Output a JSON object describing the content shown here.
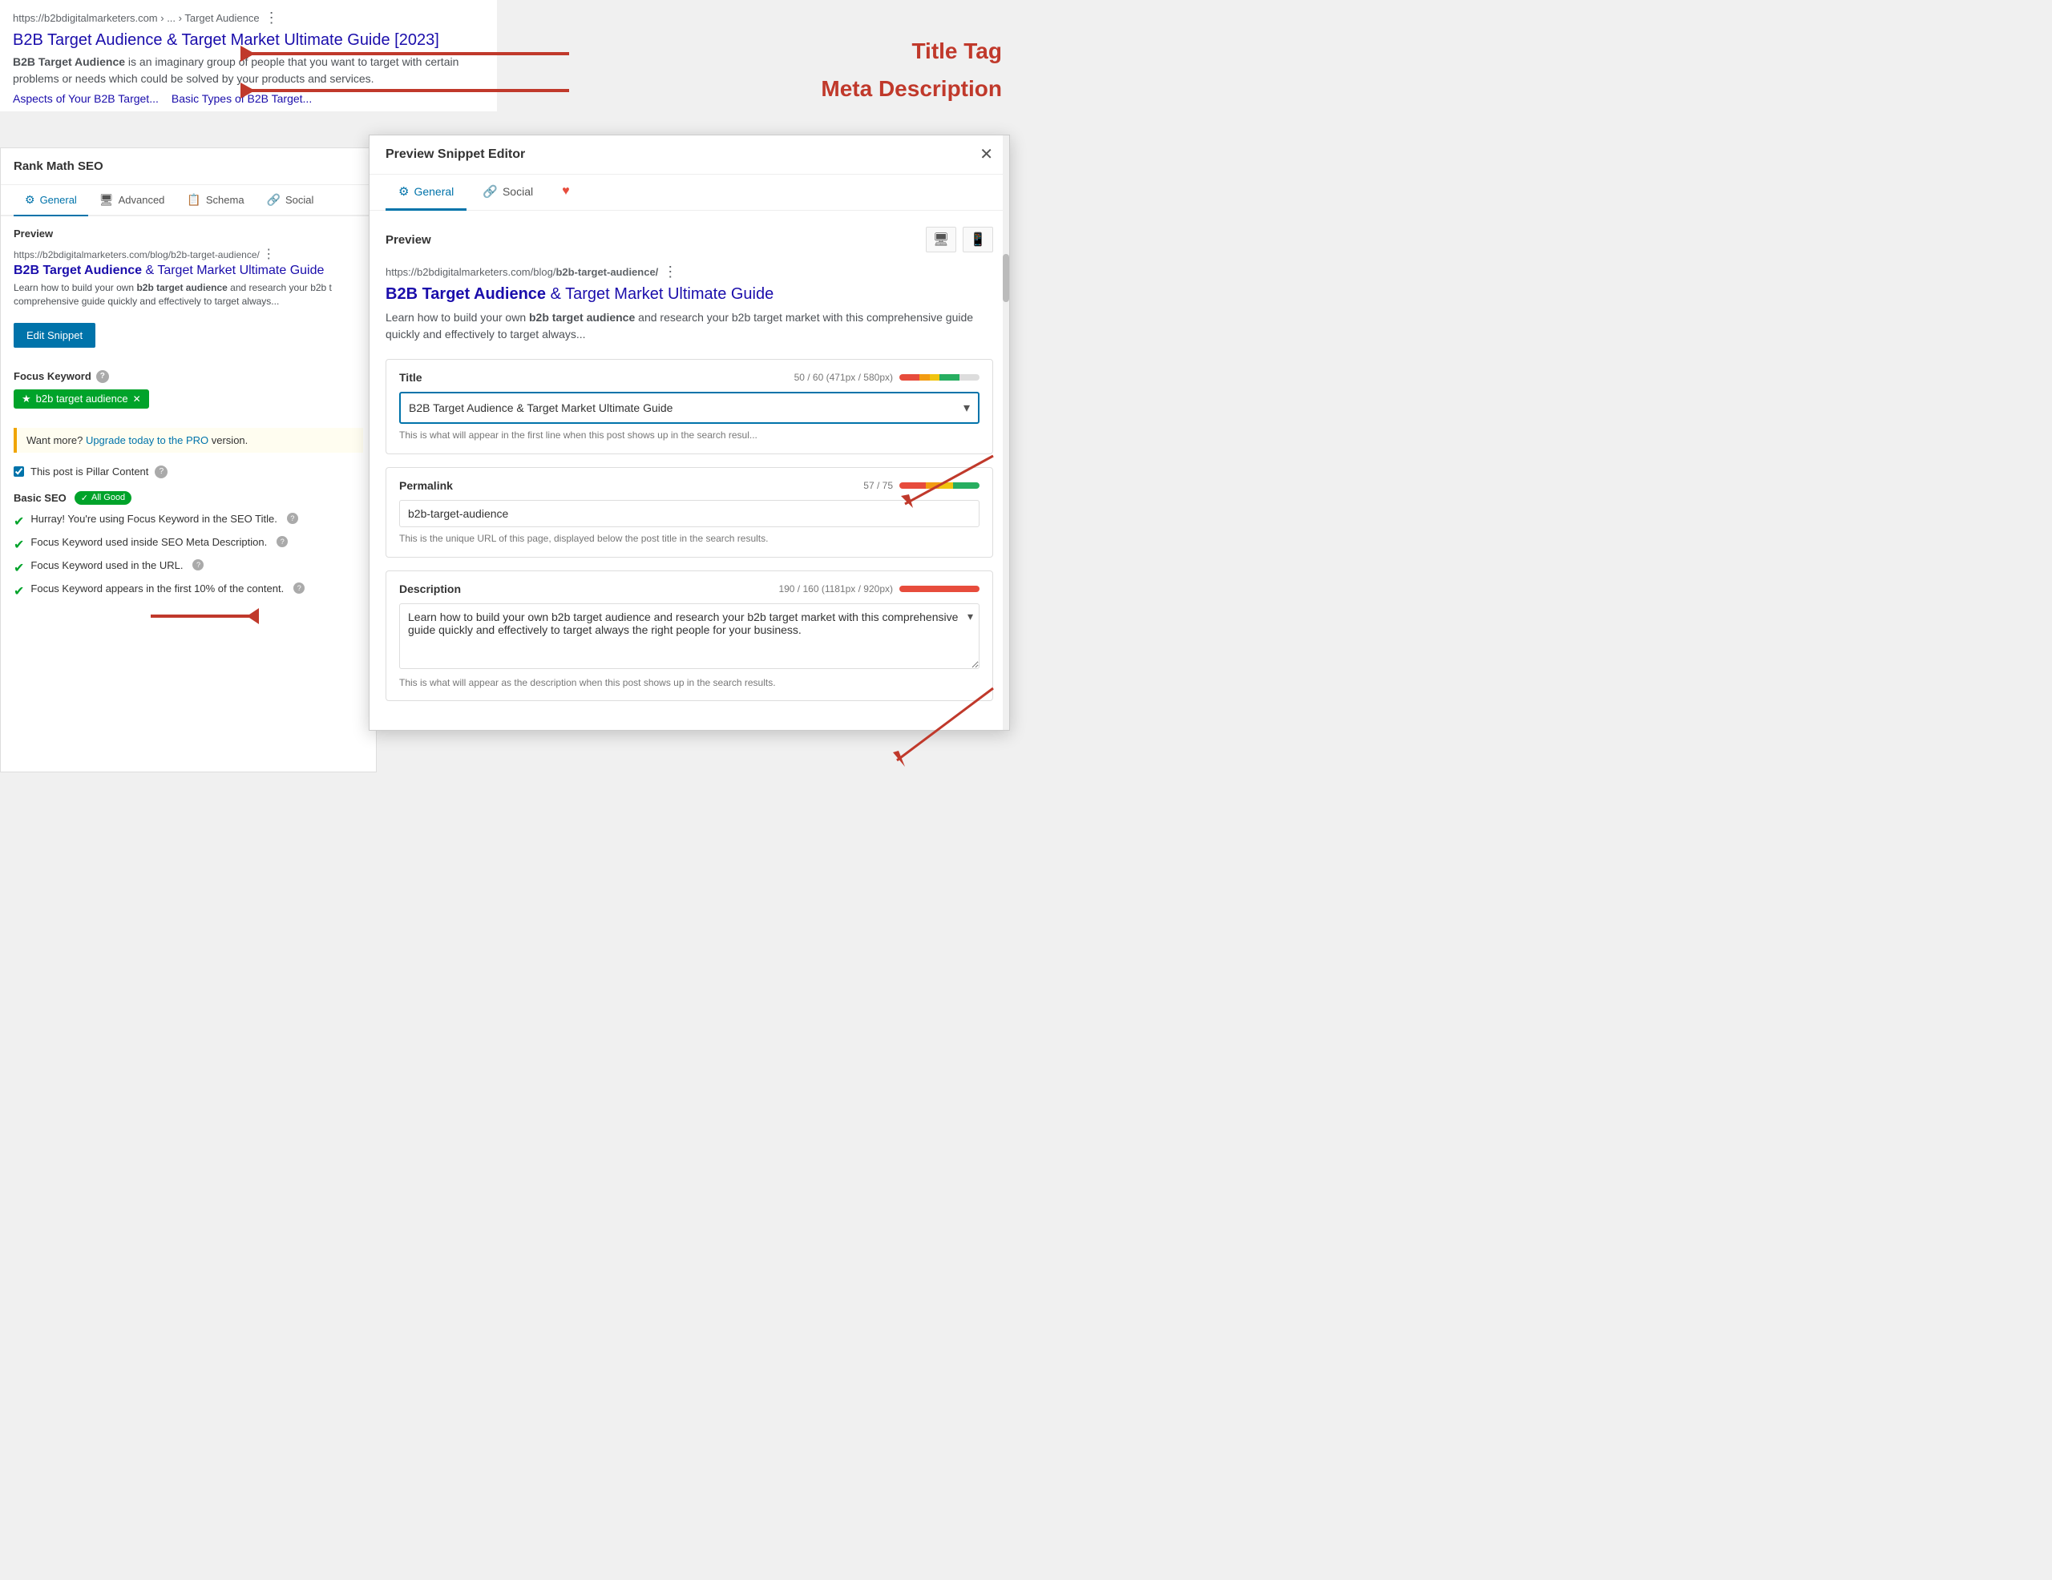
{
  "serp": {
    "url": "https://b2bdigitalmarketers.com › ... › Target Audience",
    "url_dots": "⋮",
    "title": "B2B Target Audience & Target Market Ultimate Guide [2023]",
    "description_bold": "B2B Target Audience",
    "description_rest": " is an imaginary group of people that you want to target with certain problems or needs which could be solved by your products and services.",
    "link1": "Aspects of Your B2B Target...",
    "link2": "Basic Types of B2B Target..."
  },
  "annotations": {
    "title_tag": "Title Tag",
    "meta_desc": "Meta Description"
  },
  "rank_math": {
    "header": "Rank Math SEO",
    "tabs": [
      {
        "label": "General",
        "icon": "⚙",
        "active": true
      },
      {
        "label": "Advanced",
        "icon": "🖥",
        "active": false
      },
      {
        "label": "Schema",
        "icon": "📋",
        "active": false
      },
      {
        "label": "Social",
        "icon": "🔗",
        "active": false
      }
    ],
    "preview_label": "Preview",
    "preview_url": "https://b2bdigitalmarketers.com/blog/",
    "preview_url_bold": "b2b-target-audience/",
    "preview_title_normal": "& Target Market Ultimate Guide",
    "preview_title_bold": "B2B Target Audience",
    "preview_desc": "Learn how to build your own ",
    "preview_desc_bold": "b2b target audience",
    "preview_desc_rest": " and research your b2b t comprehensive guide quickly and effectively to target always...",
    "edit_snippet_label": "Edit Snippet",
    "focus_keyword_label": "Focus Keyword",
    "focus_keyword_tag": "b2b target audience",
    "upgrade_text": "Want more? ",
    "upgrade_link": "Upgrade today to the PRO",
    "upgrade_rest": " version.",
    "pillar_label": "This post is Pillar Content",
    "basic_seo_label": "Basic SEO",
    "all_good_label": "✓ All Good",
    "seo_checks": [
      "Hurray! You're using Focus Keyword in the SEO Title.",
      "Focus Keyword used inside SEO Meta Description.",
      "Focus Keyword used in the URL.",
      "Focus Keyword appears in the first 10% of the content."
    ]
  },
  "modal": {
    "title": "Preview Snippet Editor",
    "close": "✕",
    "tabs": [
      {
        "label": "General",
        "icon": "⚙",
        "active": true
      },
      {
        "label": "Social",
        "icon": "🔗",
        "active": false
      },
      {
        "label": "heart",
        "icon": "♥",
        "active": false
      }
    ],
    "preview_label": "Preview",
    "device_desktop": "🖥",
    "device_mobile": "📱",
    "serp_url": "https://b2bdigitalmarketers.com/blog/",
    "serp_url_bold": "b2b-target-audience/",
    "serp_url_dots": "⋮",
    "serp_title_bold": "B2B Target Audience",
    "serp_title_rest": " & Target Market Ultimate Guide",
    "serp_desc_intro": "Learn how to build your own ",
    "serp_desc_bold": "b2b target audience",
    "serp_desc_rest": " and research your b2b target market with this comprehensive guide quickly and effectively to target always...",
    "title_field": {
      "label": "Title",
      "counter": "50 / 60 (471px / 580px)",
      "value": "B2B Target Audience &amp; Target Market Ultimate Guide",
      "hint": "This is what will appear in the first line when this post shows up in the search resul...",
      "bar_segments": [
        "red",
        "orange",
        "yellow",
        "green",
        "gray"
      ]
    },
    "permalink_field": {
      "label": "Permalink",
      "counter": "57 / 75",
      "value": "b2b-target-audience",
      "hint": "This is the unique URL of this page, displayed below the post title in the search results.",
      "bar_segments": [
        "red",
        "orange",
        "yellow",
        "green"
      ]
    },
    "description_field": {
      "label": "Description",
      "counter": "190 / 160 (1181px / 920px)",
      "value": "Learn how to build your own b2b target audience and research your b2b target market with this comprehensive guide quickly and effectively to target always the right people for your business.",
      "hint": "This is what will appear as the description when this post shows up in the search results.",
      "bar_segments": [
        "all_red"
      ]
    }
  }
}
